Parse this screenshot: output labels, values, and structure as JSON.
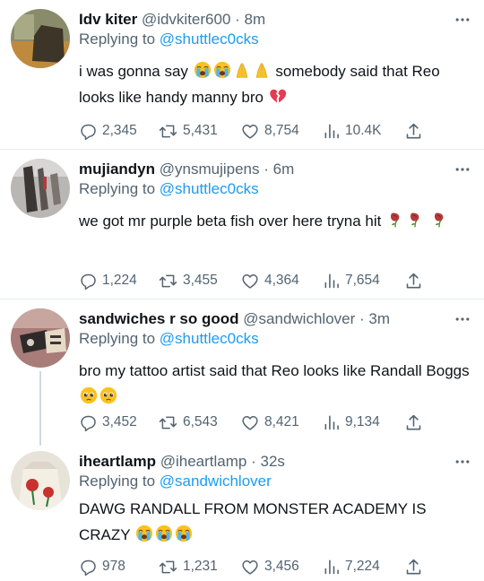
{
  "tweets": [
    {
      "name": "Idv kiter",
      "handle": "@idvkiter600",
      "dot": "·",
      "time": "8m",
      "reply_prefix": "Replying to",
      "reply_to": "@shuttlec0cks",
      "text_a": "i was gonna say",
      "text_b": "somebody said that Reo looks like handy manny bro",
      "emojis_a": [
        "loudly-crying-face",
        "loudly-crying-face",
        "folded-hands",
        "folded-hands"
      ],
      "emojis_b": [
        "broken-heart"
      ],
      "replies": "2,345",
      "retweets": "5,431",
      "likes": "8,754",
      "views": "10.4K"
    },
    {
      "name": "mujiandyn",
      "handle": "@ynsmujipens",
      "dot": "·",
      "time": "6m",
      "reply_prefix": "Replying to",
      "reply_to": "@shuttlec0cks",
      "text_a": "we got mr purple beta fish over here tryna hit",
      "emojis_a": [
        "wilted-flower",
        "wilted-flower",
        "wilted-flower"
      ],
      "replies": "1,224",
      "retweets": "3,455",
      "likes": "4,364",
      "views": "7,654"
    },
    {
      "name": "sandwiches r so good",
      "handle": "@sandwichlover",
      "dot": "·",
      "time": "3m",
      "reply_prefix": "Replying to",
      "reply_to": "@shuttlec0cks",
      "text_a": "bro my tattoo artist said that Reo looks like Randall Boggs",
      "emojis_a": [
        "pleading-face",
        "pleading-face"
      ],
      "replies": "3,452",
      "retweets": "6,543",
      "likes": "8,421",
      "views": "9,134"
    },
    {
      "name": "iheartlamp",
      "handle": "@iheartlamp",
      "dot": "·",
      "time": "32s",
      "reply_prefix": "Replying to",
      "reply_to": "@sandwichlover",
      "text_a": "DAWG RANDALL FROM MONSTER ACADEMY IS CRAZY",
      "emojis_a": [
        "loudly-crying-face",
        "loudly-crying-face",
        "loudly-crying-face"
      ],
      "replies": "978",
      "retweets": "1,231",
      "likes": "3,456",
      "views": "7,224"
    }
  ],
  "colors": {
    "text": "#0f1419",
    "muted": "#536471",
    "link": "#1d9bf0",
    "divider": "#e6ecf0",
    "thread": "#cfd9de"
  },
  "icons": [
    "reply-icon",
    "retweet-icon",
    "like-icon",
    "views-icon",
    "share-icon",
    "more-icon"
  ]
}
